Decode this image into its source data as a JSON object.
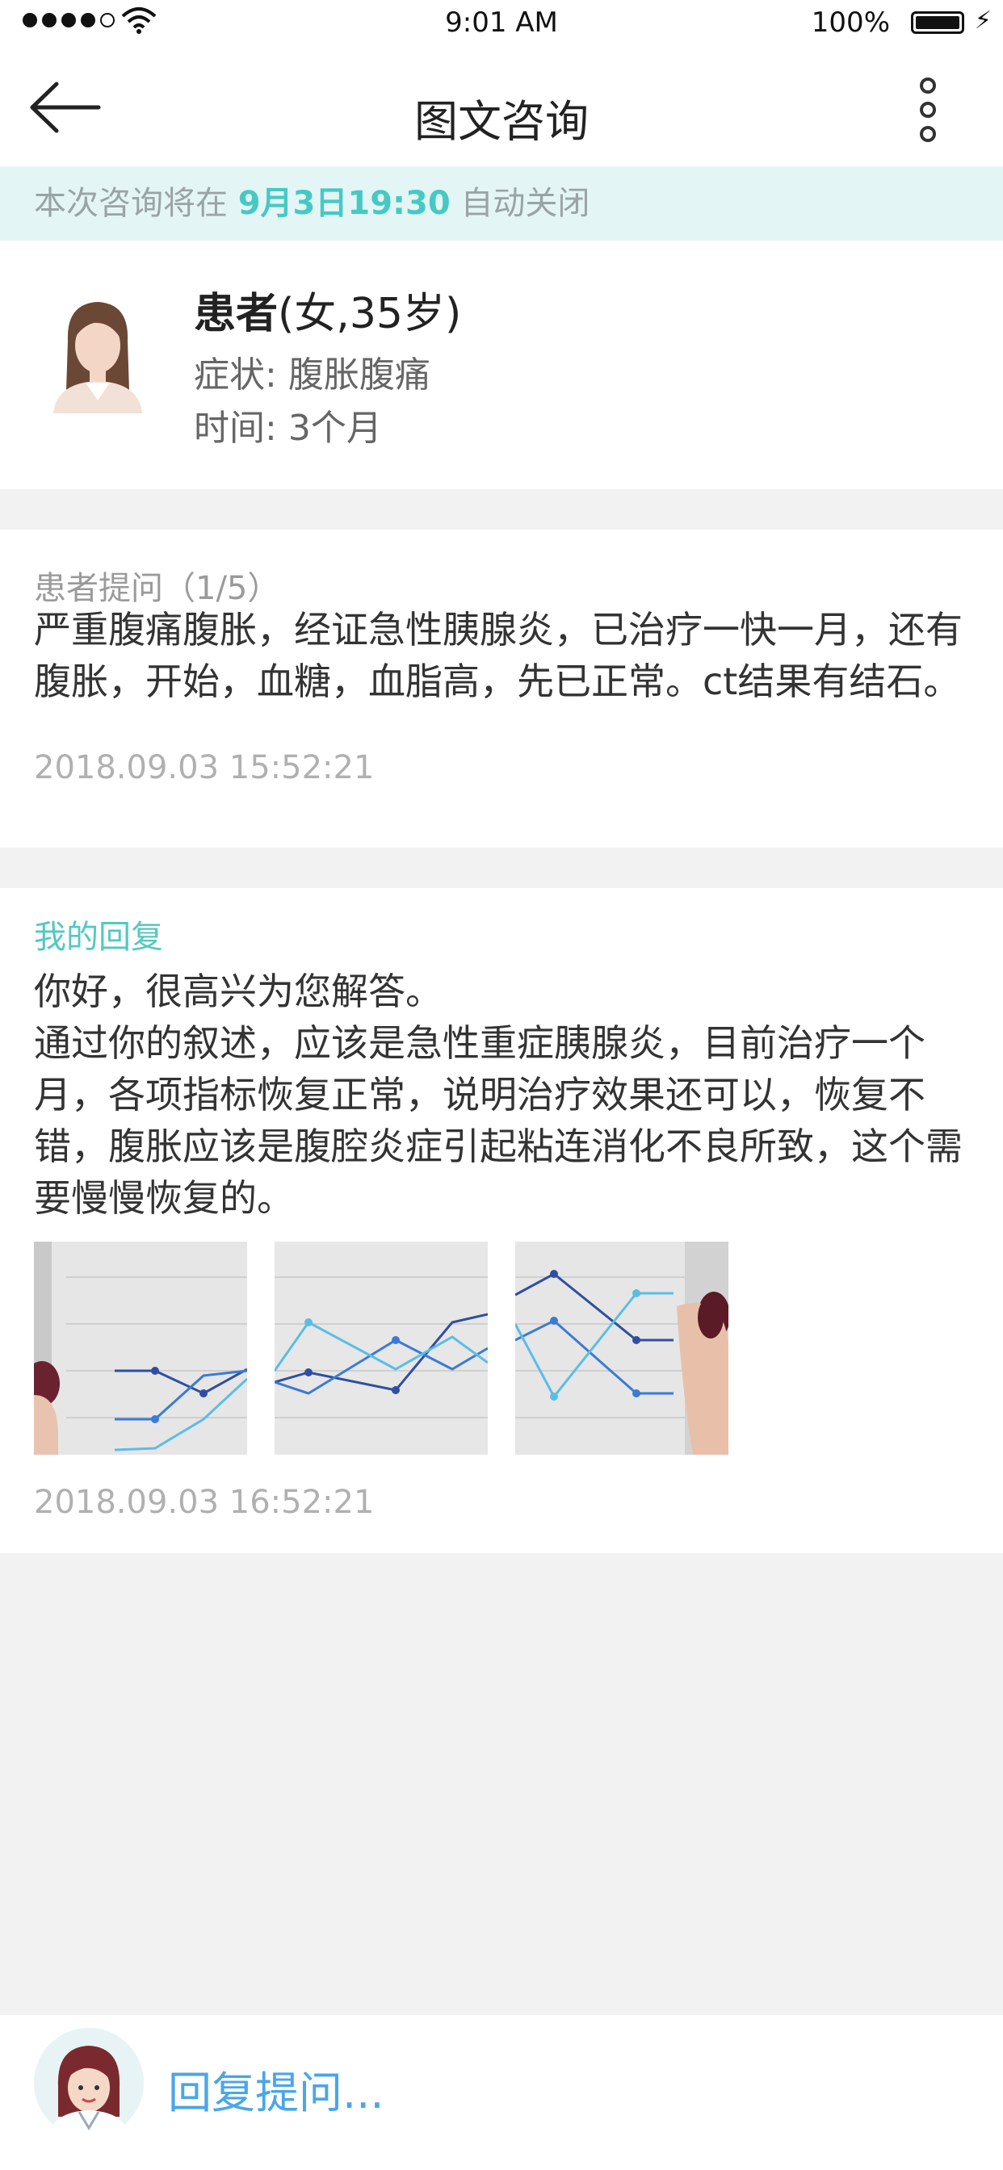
{
  "status_bar": {
    "time": "9:01 AM",
    "battery": "100%"
  },
  "nav": {
    "title": "图文咨询"
  },
  "notice": {
    "prefix": "本次咨询将在",
    "deadline": "9月3日19:30",
    "suffix": "自动关闭"
  },
  "patient": {
    "label": "患者",
    "meta": "(女,35岁)",
    "symptom_label": "症状:",
    "symptom": "腹胀腹痛",
    "duration_label": "时间:",
    "duration": "3个月"
  },
  "question": {
    "label": "患者提问（1/5）",
    "text": "严重腹痛腹胀，经证急性胰腺炎，已治疗一快一月，还有腹胀，开始，血糖，血脂高，先已正常。ct结果有结石。",
    "time": "2018.09.03 15:52:21"
  },
  "reply": {
    "label": "我的回复",
    "line1": "你好，很高兴为您解答。",
    "line2": "通过你的叙述，应该是急性重症胰腺炎，目前治疗一个月，各项指标恢复正常，说明治疗效果还可以，恢复不错，腹胀应该是腹腔炎症引起粘连消化不良所致，这个需要慢慢恢复的。",
    "time": "2018.09.03 16:52:21"
  },
  "reply_bar": {
    "placeholder": "回复提问..."
  },
  "colors": {
    "accent": "#46c9c3",
    "link": "#4aa6e8",
    "notice_bg": "#e3f6f5"
  }
}
